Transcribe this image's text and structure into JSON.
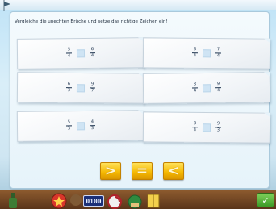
{
  "instruction": "Vergleiche die unechten Brüche und setze das richtige Zeichen ein!",
  "cards": [
    {
      "left": {
        "num": "5",
        "den": "4"
      },
      "right": {
        "num": "6",
        "den": "4"
      }
    },
    {
      "left": {
        "num": "8",
        "den": "4"
      },
      "right": {
        "num": "7",
        "den": "4"
      }
    },
    {
      "left": {
        "num": "6",
        "den": "3"
      },
      "right": {
        "num": "9",
        "den": "7"
      }
    },
    {
      "left": {
        "num": "8",
        "den": "4"
      },
      "right": {
        "num": "9",
        "den": "4"
      }
    },
    {
      "left": {
        "num": "5",
        "den": "3"
      },
      "right": {
        "num": "4",
        "den": "3"
      }
    },
    {
      "left": {
        "num": "8",
        "den": "4"
      },
      "right": {
        "num": "9",
        "den": "3"
      }
    }
  ],
  "signs": {
    "greater": ">",
    "equal": "=",
    "less": "<"
  },
  "bottom_bar": {
    "counter": "0100",
    "ok_icon": "check-icon"
  },
  "colors": {
    "sign_button": "#f5b800",
    "counter_bg": "#1b2f77",
    "panel": "#e6f3fa"
  }
}
